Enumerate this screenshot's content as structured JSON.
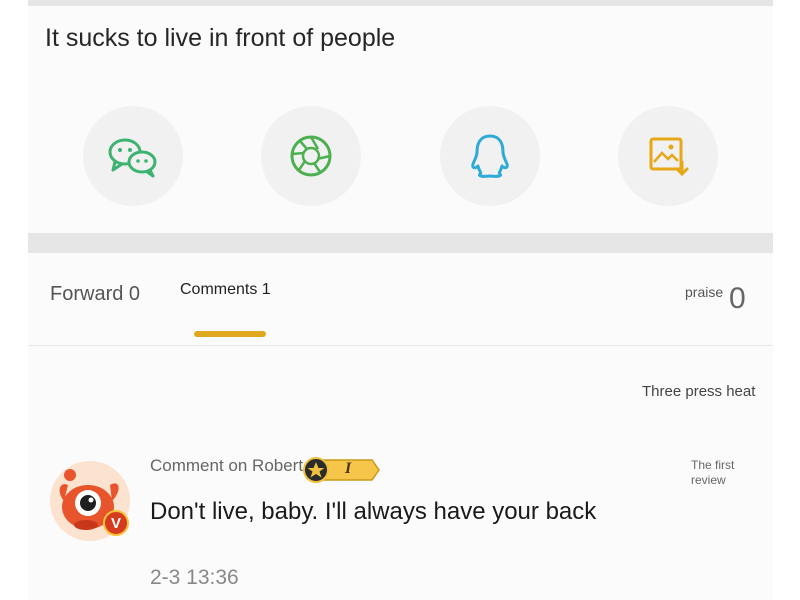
{
  "post": {
    "title": "It sucks to live in front of people"
  },
  "share": {
    "items": [
      {
        "icon": "wechat-icon",
        "color": "#3cb371"
      },
      {
        "icon": "moments-icon",
        "color": "#4caf50"
      },
      {
        "icon": "qq-icon",
        "color": "#2fa9d6"
      },
      {
        "icon": "save-image-icon",
        "color": "#e6a817"
      }
    ]
  },
  "tabs": {
    "forward": "Forward 0",
    "comments": "Comments 1",
    "praise_label": "praise",
    "praise_count": "0",
    "active_color": "#e0a81f"
  },
  "comments": {
    "sort_label": "Three press heat",
    "items": [
      {
        "author": "Comment on Robert",
        "badge_level": "I",
        "first_review": "The first review",
        "text": "Don't live, baby. I'll always have your back",
        "time": "2-3 13:36",
        "verified_mark": "V"
      }
    ]
  }
}
